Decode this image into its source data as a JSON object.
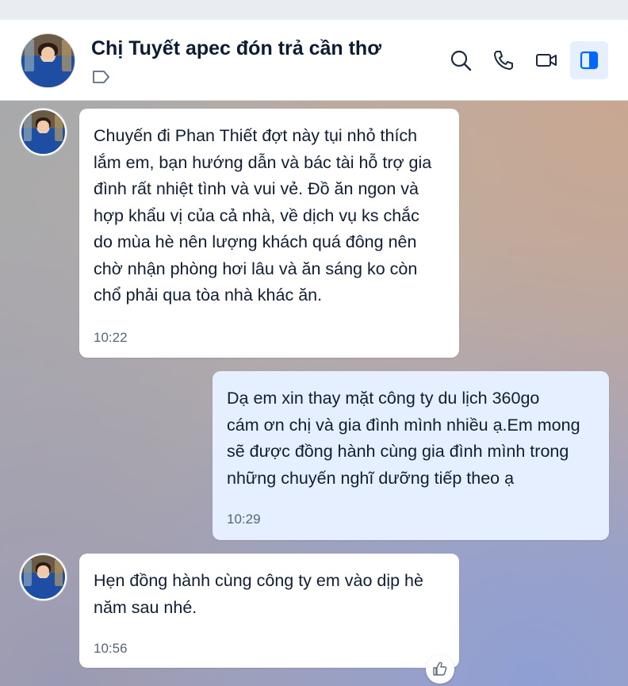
{
  "header": {
    "title": "Chị Tuyết apec đón trả cần thơ",
    "icons": [
      "search-icon",
      "phone-icon",
      "video-call-icon",
      "side-panel-icon"
    ],
    "accent": "#0068ff"
  },
  "messages": [
    {
      "direction": "incoming",
      "text": "Chuyến đi Phan Thiết đợt này tụi nhỏ thích\nlắm em, bạn hướng dẫn và bác tài hỗ trợ gia\nđình rất nhiệt tình và vui vẻ. Đồ ăn ngon và\nhợp khẩu vị của cả nhà, về dịch vụ ks chắc\ndo mùa hè nên lượng khách quá đông nên\nchờ nhận phòng hơi lâu và ăn sáng ko còn\nchổ phải qua tòa nhà khác ăn.",
      "time": "10:22"
    },
    {
      "direction": "outgoing",
      "text": "Dạ em xin thay mặt công ty du lịch 360go\ncám ơn chị và gia đình mình nhiều ạ.Em mong\nsẽ được đồng hành cùng gia đình mình trong\nnhững chuyến nghĩ dưỡng tiếp theo ạ",
      "time": "10:29"
    },
    {
      "direction": "incoming",
      "text": "Hẹn đồng hành cùng công ty em vào dịp hè\nnăm sau nhé.",
      "time": "10:56"
    }
  ]
}
